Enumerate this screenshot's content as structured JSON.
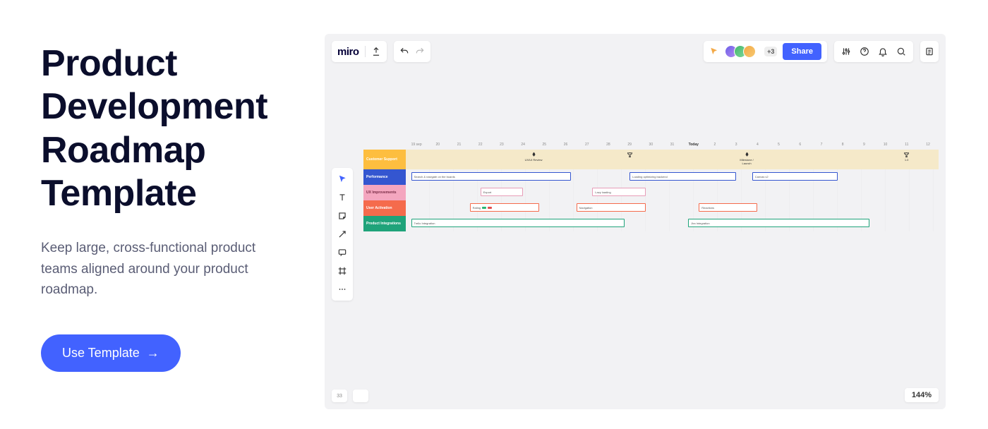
{
  "hero": {
    "title_line1": "Product",
    "title_line2": "Development",
    "title_line3": "Roadmap",
    "title_line4": "Template",
    "subtitle": "Keep large, cross-functional product teams aligned around your product roadmap.",
    "cta_label": "Use Template"
  },
  "board": {
    "logo": "miro",
    "avatar_overflow": "+3",
    "share_label": "Share",
    "zoom": "144%",
    "bottom_left_count": "33",
    "dates": [
      "19 sep",
      "20",
      "21",
      "22",
      "23",
      "24",
      "25",
      "26",
      "27",
      "28",
      "29",
      "30",
      "31",
      "Today",
      "2",
      "3",
      "4",
      "5",
      "6",
      "7",
      "8",
      "9",
      "10",
      "11",
      "12"
    ],
    "lanes": {
      "customer_support": "Customer Support",
      "performance": "Performance",
      "ux": "UX Improvements",
      "activation": "User Activation",
      "integrations": "Product Integrations"
    },
    "milestones": {
      "m1": "UX/UI Review",
      "m2": "",
      "m3": "Milestone / Launch",
      "m4": "1.0"
    },
    "tasks": {
      "perf1": "Search & navigate on the boards",
      "perf2": "Loading optimizing backend",
      "perf3": "Canvas v2",
      "ux1": "Export",
      "ux2": "Lazy loading",
      "act1": "Rating",
      "act2": "Navigation",
      "act3": "Reactions",
      "pi1": "Trello Integration",
      "pi2": "Jira Integration"
    }
  }
}
